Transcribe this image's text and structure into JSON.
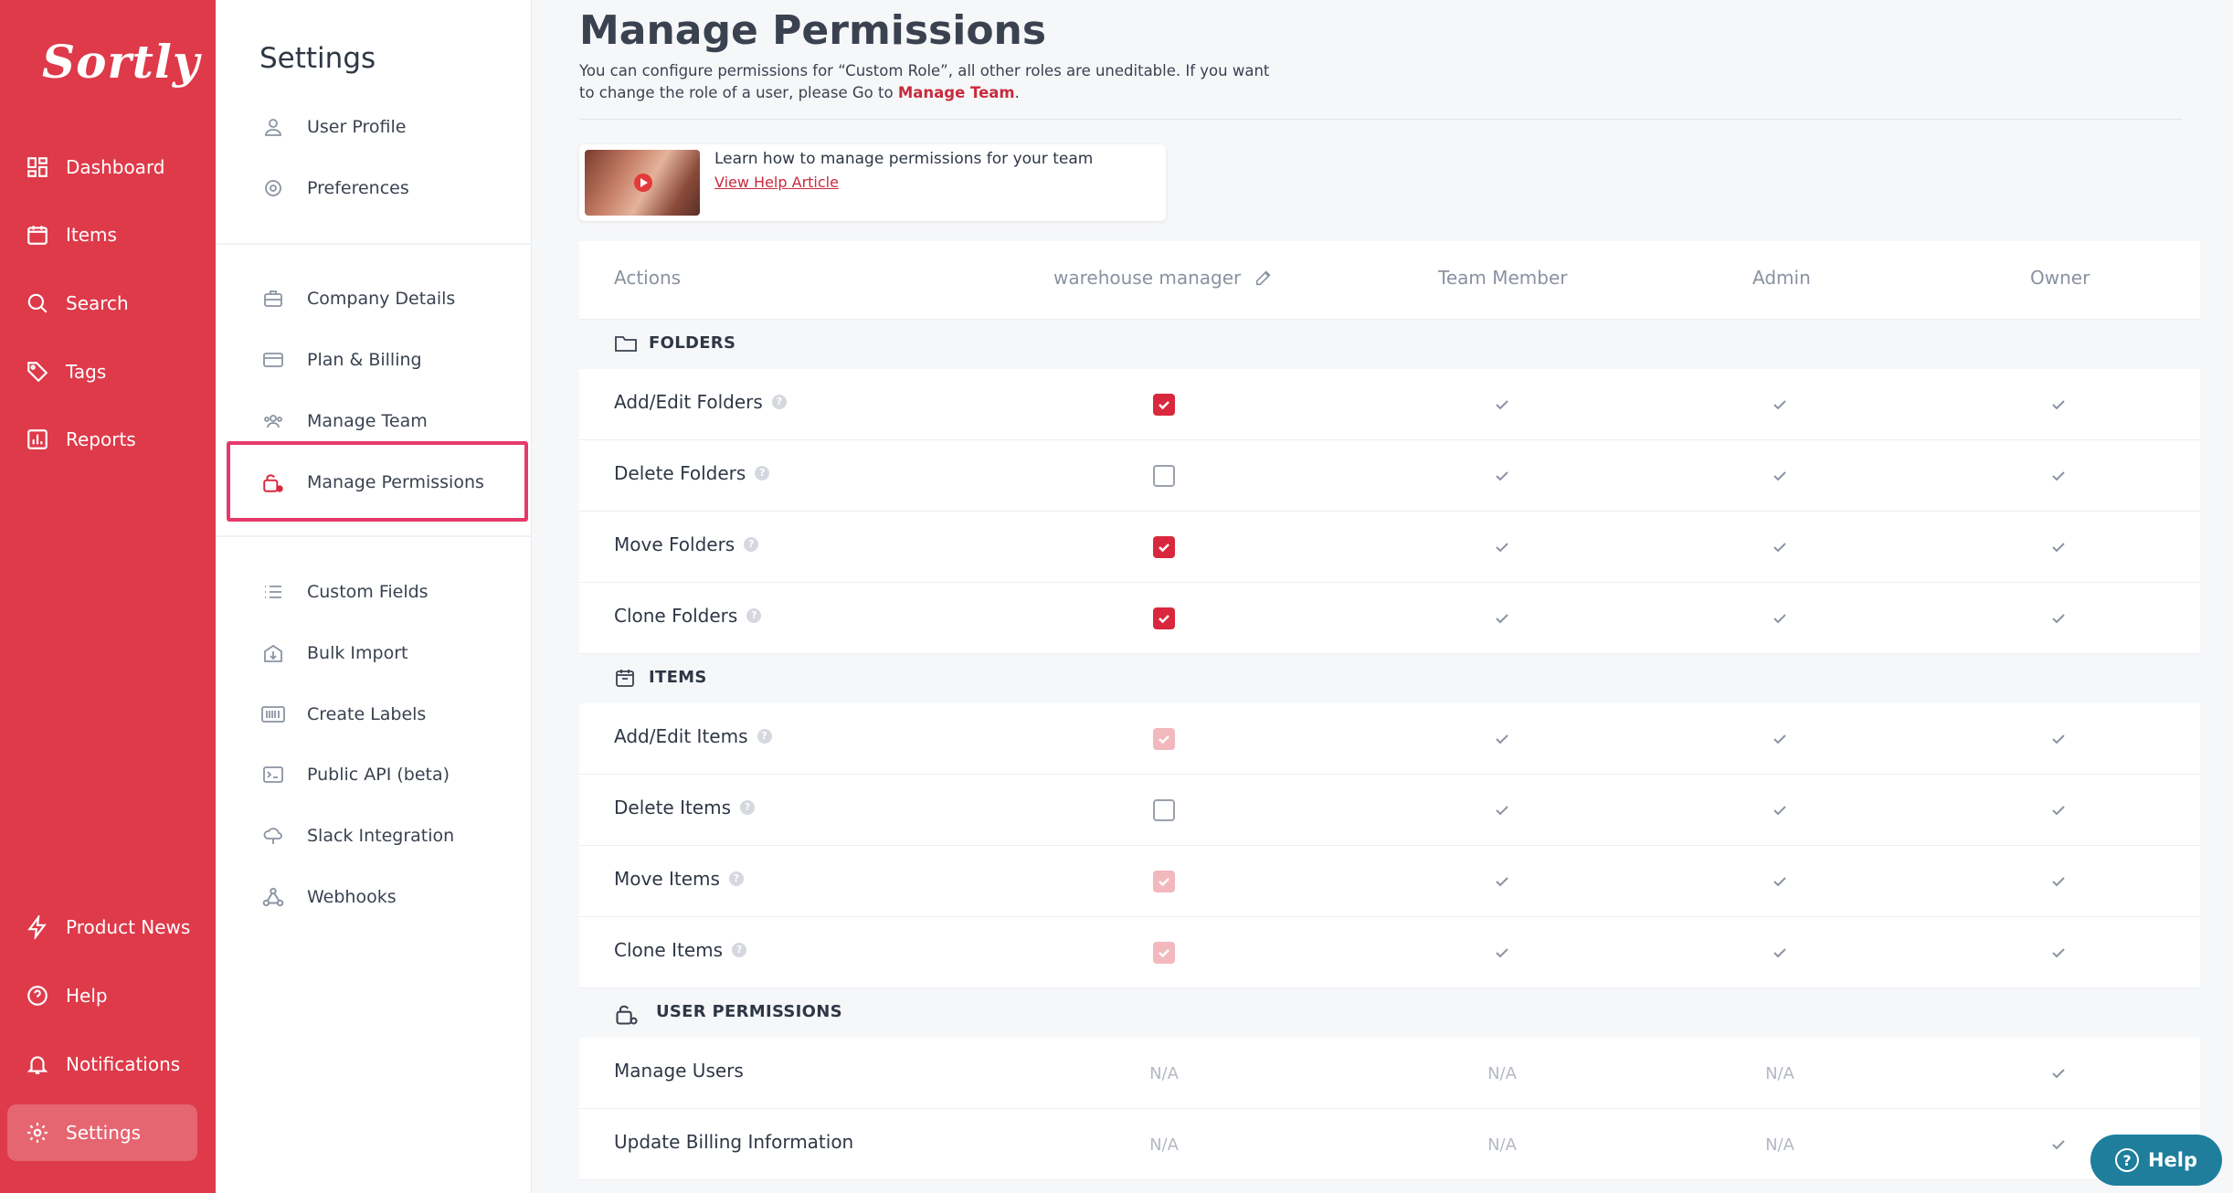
{
  "app": {
    "logo": "Sortly"
  },
  "nav": {
    "top": [
      {
        "label": "Dashboard",
        "icon": "dashboard-icon"
      },
      {
        "label": "Items",
        "icon": "items-icon"
      },
      {
        "label": "Search",
        "icon": "search-icon"
      },
      {
        "label": "Tags",
        "icon": "tag-icon"
      },
      {
        "label": "Reports",
        "icon": "reports-icon"
      }
    ],
    "bottom": [
      {
        "label": "Product News",
        "icon": "lightning-icon"
      },
      {
        "label": "Help",
        "icon": "help-icon"
      },
      {
        "label": "Notifications",
        "icon": "bell-icon"
      },
      {
        "label": "Settings",
        "icon": "gear-icon"
      }
    ]
  },
  "settings": {
    "title": "Settings",
    "items": [
      {
        "label": "User Profile",
        "icon": "user-icon"
      },
      {
        "label": "Preferences",
        "icon": "gear-icon"
      },
      {
        "label": "Company Details",
        "icon": "briefcase-icon"
      },
      {
        "label": "Plan & Billing",
        "icon": "card-icon"
      },
      {
        "label": "Manage Team",
        "icon": "team-icon"
      },
      {
        "label": "Manage Permissions",
        "icon": "lock-gear-icon"
      },
      {
        "label": "Custom Fields",
        "icon": "list-icon"
      },
      {
        "label": "Bulk Import",
        "icon": "import-icon"
      },
      {
        "label": "Create Labels",
        "icon": "barcode-icon"
      },
      {
        "label": "Public API (beta)",
        "icon": "terminal-icon"
      },
      {
        "label": "Slack Integration",
        "icon": "cloud-icon"
      },
      {
        "label": "Webhooks",
        "icon": "webhook-icon"
      }
    ]
  },
  "main": {
    "title": "Manage Permissions",
    "desc_pre": "You can configure permissions for “Custom Role”, all other roles are uneditable. If you want to change the role of a user, please Go to ",
    "desc_link": "Manage Team",
    "desc_post": ".",
    "help_card": {
      "title": "Learn how to manage permissions for your team",
      "link": "View Help Article"
    },
    "columns": {
      "actions": "Actions",
      "custom": "warehouse manager",
      "team": "Team Member",
      "admin": "Admin",
      "owner": "Owner"
    },
    "sections": [
      {
        "label": "FOLDERS",
        "rows": [
          {
            "name": "Add/Edit Folders",
            "custom": "checked"
          },
          {
            "name": "Delete Folders",
            "custom": "unchecked"
          },
          {
            "name": "Move Folders",
            "custom": "checked"
          },
          {
            "name": "Clone Folders",
            "custom": "checked"
          }
        ]
      },
      {
        "label": "ITEMS",
        "rows": [
          {
            "name": "Add/Edit Items",
            "custom": "disabled"
          },
          {
            "name": "Delete Items",
            "custom": "unchecked"
          },
          {
            "name": "Move Items",
            "custom": "disabled"
          },
          {
            "name": "Clone Items",
            "custom": "disabled"
          }
        ]
      },
      {
        "label": "USER PERMISSIONS",
        "rows": [
          {
            "name": "Manage Users",
            "na": "N/A"
          },
          {
            "name": "Update Billing Information",
            "na": "N/A"
          }
        ]
      }
    ],
    "help_button": "Help"
  },
  "colors": {
    "brand": "#de3a4a",
    "checkbox": "#d9283d",
    "help_button": "#1e7e9c",
    "highlight": "#e6396b"
  }
}
